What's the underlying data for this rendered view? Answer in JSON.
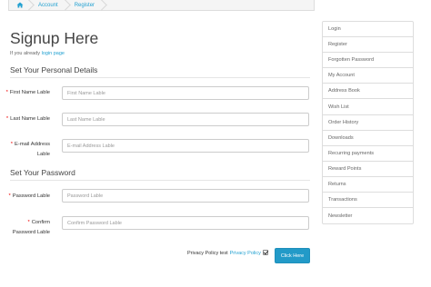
{
  "breadcrumb": {
    "home_icon": "home-icon",
    "items": [
      "Account",
      "Register"
    ]
  },
  "page": {
    "title": "Signup Here",
    "login_note_prefix": "If you already",
    "login_link": "login page"
  },
  "personal": {
    "legend": "Set Your Personal Details",
    "first_name": {
      "label": "First Name Lable",
      "placeholder": "First Name Lable"
    },
    "last_name": {
      "label": "Last Name Lable",
      "placeholder": "Last Name Lable"
    },
    "email": {
      "label": "E-mail Address Lable",
      "placeholder": "E-mail Address Lable"
    }
  },
  "password": {
    "legend": "Set Your Password",
    "password": {
      "label": "Password Lable",
      "placeholder": "Password Lable"
    },
    "confirm": {
      "label": "Confirm Password Lable",
      "placeholder": "Confirm Password Lable"
    }
  },
  "required_marker": "*",
  "agree": {
    "text": "Privacy Policy test",
    "link": "Privacy Policy",
    "checked": true
  },
  "submit_label": "Click Here",
  "colors": {
    "accent": "#229ac8",
    "link": "#23a1d1",
    "required": "#f00000"
  },
  "sidebar": {
    "items": [
      "Login",
      "Register",
      "Forgotten Password",
      "My Account",
      "Address Book",
      "Wish List",
      "Order History",
      "Downloads",
      "Recurring payments",
      "Reward Points",
      "Returns",
      "Transactions",
      "Newsletter"
    ]
  }
}
